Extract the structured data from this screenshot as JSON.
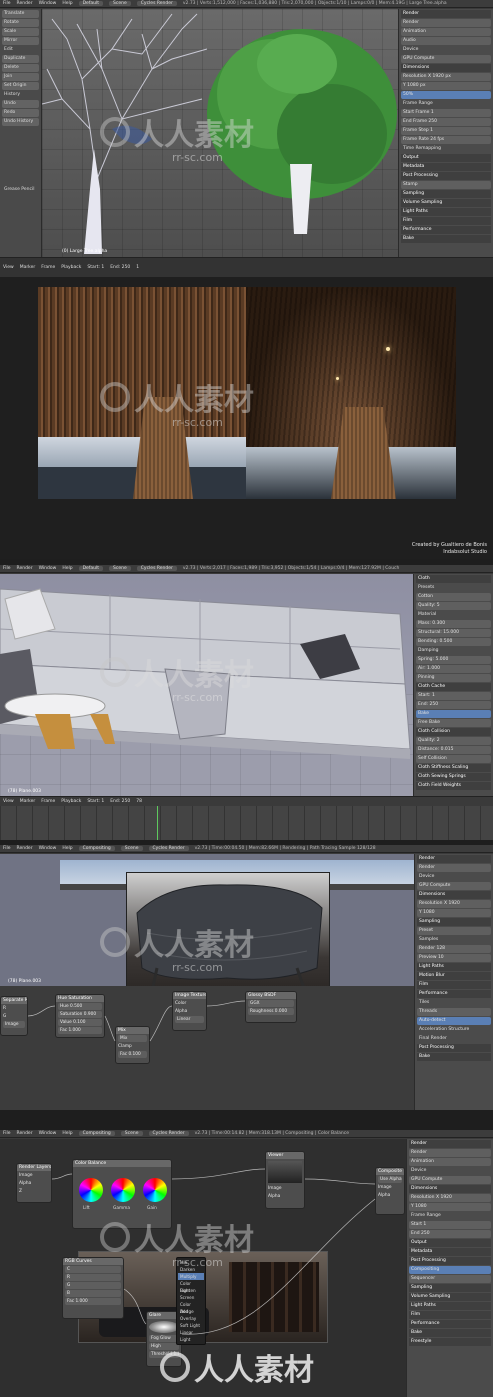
{
  "watermark": {
    "brand": "人人素材",
    "url": "rr-sc.com"
  },
  "panel1": {
    "menu": [
      "File",
      "Render",
      "Window",
      "Help",
      "Default",
      "Scene",
      "Cycles Render"
    ],
    "scene_info": "v2.73 | Verts:1,512,000 | Faces:1,036,880 | Tris:2,070,000 | Objects:1/10 | Lamps:0/0 | Mem:4.19G | Large Tree.alpha",
    "tools": [
      "Translate",
      "Rotate",
      "Scale",
      "Mirror",
      "Edit",
      "Duplicate",
      "Delete",
      "Join",
      "Set Origin",
      "History",
      "Undo",
      "Redo",
      "Undo History",
      "Grease Pencil"
    ],
    "viewport_label": "(0) Large Tree.alpha",
    "props": [
      "Render",
      "Render",
      "Animation",
      "Audio",
      "Device",
      "GPU Compute",
      "Dimensions",
      "Resolution X 1920 px",
      "Y 1080 px",
      "50%",
      "Frame Range",
      "Start Frame 1",
      "End Frame 250",
      "Frame Step 1",
      "Frame Rate 24 fps",
      "Time Remapping",
      "Output",
      "Metadata",
      "Post Processing",
      "Stamp",
      "Sampling",
      "Volume Sampling",
      "Light Paths",
      "Film",
      "Performance",
      "Bake"
    ],
    "timeline": [
      "View",
      "Marker",
      "Frame",
      "Playback",
      "Start: 1",
      "End: 250",
      "1"
    ]
  },
  "panel2": {
    "credit_line1": "Created by Gualtiero de Bonis",
    "credit_line2": "Indabsolut Studio"
  },
  "panel3": {
    "menu": [
      "File",
      "Render",
      "Window",
      "Help",
      "Default",
      "Scene",
      "Cycles Render"
    ],
    "scene_info": "v2.73 | Verts:2,017 | Faces:1,989 | Tris:3,952 | Objects:1/54 | Lamps:0/4 | Mem:127.92M | Couch",
    "viewport_label": "(78) Plane.003",
    "props": [
      "Cloth",
      "Presets",
      "Cotton",
      "Quality: 5",
      "Material",
      "Mass: 0.300",
      "Structural: 15.000",
      "Bending: 0.500",
      "Damping",
      "Spring: 5.000",
      "Air: 1.000",
      "Pinning",
      "Cloth Cache",
      "Start: 1",
      "End: 250",
      "Bake",
      "Free Bake",
      "Cloth Collision",
      "Quality: 2",
      "Distance: 0.015",
      "Self Collision",
      "Cloth Stiffness Scaling",
      "Cloth Sewing Springs",
      "Cloth Field Weights"
    ],
    "timeline": [
      "View",
      "Marker",
      "Frame",
      "Playback",
      "Start: 1",
      "End: 250",
      "78"
    ]
  },
  "panel4": {
    "menu": [
      "File",
      "Render",
      "Window",
      "Help",
      "Compositing",
      "Scene",
      "Cycles Render"
    ],
    "scene_info": "v2.73 | Time:00:04.50 | Mem:82.66M | Rendering | Path Tracing Sample 128/128",
    "viewport_label": "(78) Plane.003",
    "nodes": [
      {
        "title": "Hue Saturation",
        "rows": [
          "Hue 0.500",
          "Saturation 0.900",
          "Value 0.100",
          "Fac 1.000",
          "Color"
        ]
      },
      {
        "title": "Mix",
        "rows": [
          "Mix",
          "Clamp",
          "Fac 0.100"
        ]
      },
      {
        "title": "Image Texture",
        "rows": [
          "Color",
          "Alpha",
          "Linear",
          "Flat",
          "Repeat"
        ]
      },
      {
        "title": "Glossy BSDF",
        "rows": [
          "BSDF",
          "GGX",
          "Color",
          "Roughness 0.000"
        ]
      },
      {
        "title": "Separate RGB",
        "rows": [
          "R",
          "G",
          "B",
          "Image"
        ]
      }
    ],
    "props": [
      "Render",
      "Render",
      "Device",
      "GPU Compute",
      "Dimensions",
      "Resolution X 1920",
      "Y 1080",
      "Sampling",
      "Preset",
      "Samples",
      "Render 128",
      "Preview 10",
      "Light Paths",
      "Motion Blur",
      "Film",
      "Performance",
      "Tiles",
      "Threads",
      "Auto-detect",
      "Acceleration Structure",
      "Final Render",
      "Post Processing",
      "Bake"
    ]
  },
  "panel5": {
    "menu": [
      "File",
      "Render",
      "Window",
      "Help",
      "Compositing",
      "Scene",
      "Cycles Render"
    ],
    "scene_info": "v2.73 | Time:00:14.82 | Mem:318.13M | Compositing | Color Balance",
    "nodes": [
      {
        "title": "Color Balance",
        "rows": [
          "Lift",
          "Gamma",
          "Gain",
          "Offset/Power/Slope"
        ]
      },
      {
        "title": "Render Layers",
        "rows": [
          "Image",
          "Alpha",
          "Z",
          "Normal"
        ]
      },
      {
        "title": "Viewer",
        "rows": [
          "Image",
          "Alpha",
          "Z"
        ]
      },
      {
        "title": "Composite",
        "rows": [
          "Use Alpha",
          "Image",
          "Alpha",
          "Z"
        ]
      },
      {
        "title": "RGB Curves",
        "rows": [
          "C",
          "R",
          "G",
          "B",
          "Fac 1.000",
          "Image"
        ]
      },
      {
        "title": "Glare",
        "rows": [
          "Fog Glow",
          "High",
          "Mix 0.000",
          "Threshold 1.000",
          "Size 9"
        ]
      }
    ],
    "menu_popup": [
      "Mix",
      "Darken",
      "Multiply",
      "Color Burn",
      "Lighten",
      "Screen",
      "Color Dodge",
      "Add",
      "Overlay",
      "Soft Light",
      "Linear Light",
      "Difference"
    ],
    "props": [
      "Render",
      "Render",
      "Animation",
      "Device",
      "GPU Compute",
      "Dimensions",
      "Resolution X 1920",
      "Y 1080",
      "Frame Range",
      "Start 1",
      "End 250",
      "Output",
      "Metadata",
      "Post Processing",
      "Compositing",
      "Sequencer",
      "Sampling",
      "Volume Sampling",
      "Light Paths",
      "Film",
      "Performance",
      "Bake",
      "Freestyle"
    ]
  }
}
